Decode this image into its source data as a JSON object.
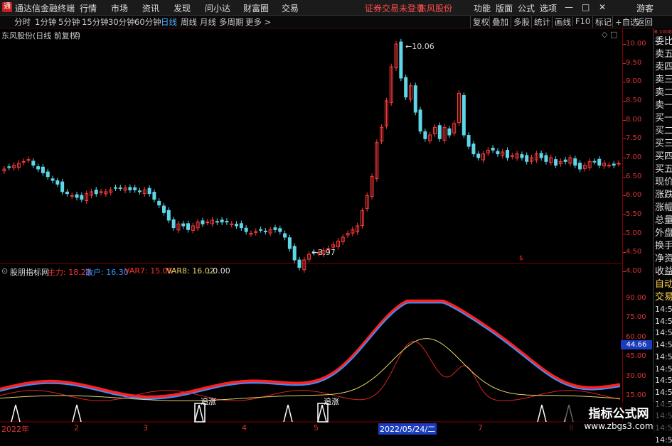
{
  "menubar": {
    "app_title": "通达信金融终端",
    "items": [
      "行情",
      "市场",
      "资讯",
      "发现",
      "问小达",
      "财富圈",
      "交易"
    ],
    "status": "证券交易未登录",
    "stock": "东风股份",
    "right_items": [
      "功能",
      "版面",
      "公式",
      "选项"
    ],
    "guest": "游客",
    "minimize": "—",
    "maximize": "□",
    "close": "✕"
  },
  "toolbar": {
    "periods": [
      "分时",
      "1分钟",
      "5分钟",
      "15分钟",
      "30分钟",
      "60分钟",
      "日线",
      "周线",
      "月线",
      "多周期",
      "更多 >"
    ],
    "active_period": "日线",
    "right_buttons": [
      "复权",
      "叠加",
      "多股",
      "统计",
      "画线",
      "F10",
      "标记",
      "+自选",
      "返回"
    ]
  },
  "chart_title": "东风股份(日线 前复权)",
  "indicator": {
    "name": "股朋指标网",
    "labels": [
      {
        "text": "主力: 18.23",
        "color": "#ff3030"
      },
      {
        "text": "散户: 16.30",
        "color": "#3d8fff"
      },
      {
        "text": "VAR7: 15.05",
        "color": "#ff3030"
      },
      {
        "text": "VAR8: 16.02",
        "color": "#e8d36a"
      },
      {
        "text": ": 0.00",
        "color": "#dddddd"
      }
    ]
  },
  "right_panel": [
    "委比",
    "卖五",
    "卖四",
    "卖三",
    "卖二",
    "卖一",
    "买一",
    "买二",
    "买三",
    "买四",
    "买五",
    "现价",
    "涨跌",
    "涨幅",
    "总量",
    "外盘",
    "换手",
    "净资",
    "收益",
    "自动",
    "交易",
    "14:56",
    "14:56",
    "14:56",
    "14:56",
    "14:56",
    "14:56",
    "14:56",
    "14:56",
    "14:56",
    "14:56",
    "14:56",
    "14:56"
  ],
  "right_panel_top": "B 1000",
  "price_axis": [
    "10.00",
    "9.50",
    "9.00",
    "8.50",
    "8.00",
    "7.50",
    "7.00",
    "6.50",
    "6.00",
    "5.50",
    "5.00",
    "4.50",
    "4.00"
  ],
  "ind_axis": [
    "90.00",
    "75.00",
    "60.00",
    "45.00",
    "30.00",
    "15.00"
  ],
  "ind_value_box": "44.66",
  "price_annotations": {
    "high": "10.06",
    "low": "3.97"
  },
  "signals": [
    "追涨",
    "追涨"
  ],
  "x_axis": [
    "2022年",
    "2",
    "3",
    "4",
    "5",
    "2022/05/24/二",
    "7",
    "8"
  ],
  "watermark": {
    "line1": "指标公式网",
    "line2": "www.zbgs3.com"
  },
  "chart_data": {
    "type": "candlestick",
    "ylim": [
      3.8,
      10.2
    ],
    "close_series": [
      6.7,
      6.75,
      6.8,
      6.85,
      6.9,
      6.95,
      6.8,
      6.7,
      6.6,
      6.5,
      6.4,
      6.3,
      6.1,
      6.05,
      6.0,
      5.95,
      5.9,
      6.05,
      6.1,
      6.05,
      6.1,
      6.1,
      6.15,
      6.2,
      6.2,
      6.2,
      6.15,
      6.15,
      6.1,
      6.15,
      6.05,
      5.9,
      5.75,
      5.55,
      5.35,
      5.15,
      5.25,
      5.2,
      5.1,
      5.2,
      5.3,
      5.25,
      5.3,
      5.35,
      5.3,
      5.3,
      5.3,
      5.25,
      5.2,
      5.15,
      5.05,
      5.0,
      5.05,
      5.1,
      5.05,
      5.1,
      5.1,
      5.05,
      4.9,
      4.6,
      4.3,
      4.1,
      4.3,
      4.45,
      4.5,
      4.5,
      4.55,
      4.6,
      4.7,
      4.8,
      4.9,
      5.0,
      5.1,
      5.2,
      5.6,
      6.0,
      6.5,
      7.4,
      7.8,
      8.5,
      9.4,
      10.0,
      9.1,
      8.6,
      8.9,
      8.2,
      7.7,
      7.5,
      7.6,
      7.8,
      7.5,
      7.8,
      7.6,
      7.9,
      8.7,
      7.6,
      7.3,
      7.1,
      7.0,
      7.1,
      7.2,
      7.2,
      7.1,
      7.15,
      7.0,
      7.05,
      7.1,
      7.0,
      6.9,
      7.0,
      7.1,
      7.0,
      6.9,
      7.0,
      6.8,
      6.9,
      6.9,
      7.0,
      6.8,
      6.7,
      6.8,
      6.9,
      6.9,
      6.8,
      6.85,
      6.8,
      6.8,
      6.85
    ]
  }
}
